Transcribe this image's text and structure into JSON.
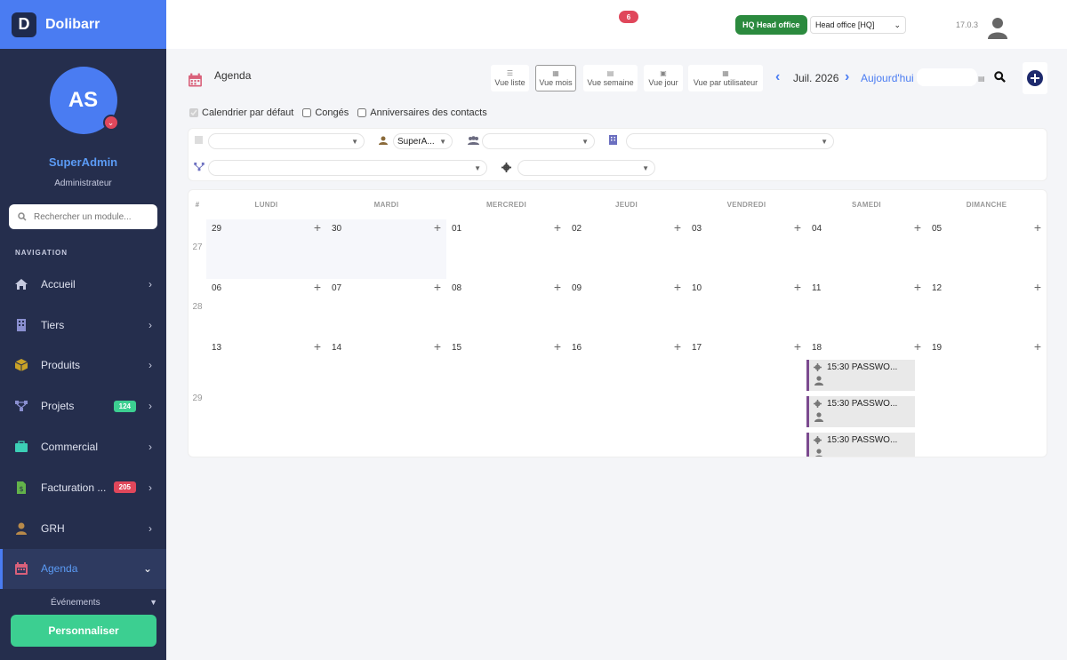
{
  "app": {
    "name": "Dolibarr",
    "logo_letter": "D",
    "version": "17.0.3"
  },
  "user": {
    "initials": "AS",
    "name": "SuperAdmin",
    "role": "Administrateur"
  },
  "sidebar": {
    "search_placeholder": "Rechercher un module...",
    "nav_title": "NAVIGATION",
    "items": [
      {
        "label": "Accueil",
        "icon": "home-icon",
        "color": "#c7cbe0"
      },
      {
        "label": "Tiers",
        "icon": "building-icon",
        "color": "#8a8fd0"
      },
      {
        "label": "Produits",
        "icon": "box-icon",
        "color": "#c9a227"
      },
      {
        "label": "Projets",
        "icon": "project-icon",
        "color": "#8a8fd0",
        "badge": "124",
        "badge_color": "#3ccf91"
      },
      {
        "label": "Commercial",
        "icon": "briefcase-icon",
        "color": "#3ccfb6"
      },
      {
        "label": "Facturation ...",
        "icon": "invoice-icon",
        "color": "#63b34a",
        "badge": "205",
        "badge_color": "#e0475b"
      },
      {
        "label": "GRH",
        "icon": "person-icon",
        "color": "#b88a4a"
      },
      {
        "label": "Agenda",
        "icon": "calendar-icon",
        "color": "#d9607a",
        "active": true
      }
    ],
    "sub_item": "Événements",
    "customize_label": "Personnaliser"
  },
  "topbar": {
    "notifications": "6",
    "entity_badge": "HQ Head office",
    "entity_select": "Head office [HQ]"
  },
  "page": {
    "title": "Agenda",
    "views": [
      "Vue liste",
      "Vue mois",
      "Vue semaine",
      "Vue jour",
      "Vue par utilisateur"
    ],
    "active_view": "Vue mois",
    "month": "Juil. 2026",
    "today": "Aujourd'hui",
    "checkboxes": [
      {
        "label": "Calendrier par défaut",
        "checked": true,
        "disabled": true
      },
      {
        "label": "Congés",
        "checked": false
      },
      {
        "label": "Anniversaires des contacts",
        "checked": false
      }
    ],
    "filters": {
      "user_value": "SuperA..."
    }
  },
  "calendar": {
    "day_names": [
      "#",
      "LUNDI",
      "MARDI",
      "MERCREDI",
      "JEUDI",
      "VENDREDI",
      "SAMEDI",
      "DIMANCHE"
    ],
    "weeks": [
      {
        "week": "27",
        "days": [
          "29",
          "30",
          "01",
          "02",
          "03",
          "04",
          "05"
        ]
      },
      {
        "week": "28",
        "days": [
          "06",
          "07",
          "08",
          "09",
          "10",
          "11",
          "12"
        ]
      },
      {
        "week": "29",
        "days": [
          "13",
          "14",
          "15",
          "16",
          "17",
          "18",
          "19"
        ]
      }
    ],
    "events": [
      {
        "day": "18",
        "text": "15:30 PASSWO..."
      },
      {
        "day": "18",
        "text": "15:30 PASSWO..."
      },
      {
        "day": "18",
        "text": "15:30 PASSWO..."
      }
    ],
    "event_color": "#7b4a8f"
  }
}
